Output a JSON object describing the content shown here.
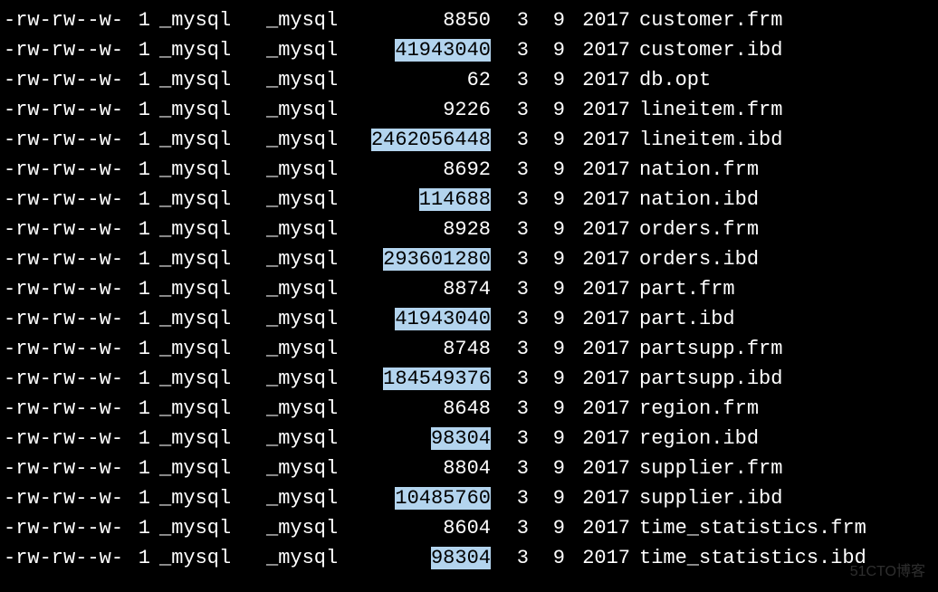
{
  "watermark": "51CTO博客",
  "listing": [
    {
      "perms": "-rw-rw--w-",
      "links": "1",
      "owner": "_mysql",
      "group": "_mysql",
      "size": "8850",
      "hl": false,
      "month": "3",
      "day": "9",
      "year": "2017",
      "name": "customer.frm"
    },
    {
      "perms": "-rw-rw--w-",
      "links": "1",
      "owner": "_mysql",
      "group": "_mysql",
      "size": "41943040",
      "hl": true,
      "month": "3",
      "day": "9",
      "year": "2017",
      "name": "customer.ibd"
    },
    {
      "perms": "-rw-rw--w-",
      "links": "1",
      "owner": "_mysql",
      "group": "_mysql",
      "size": "62",
      "hl": false,
      "month": "3",
      "day": "9",
      "year": "2017",
      "name": "db.opt"
    },
    {
      "perms": "-rw-rw--w-",
      "links": "1",
      "owner": "_mysql",
      "group": "_mysql",
      "size": "9226",
      "hl": false,
      "month": "3",
      "day": "9",
      "year": "2017",
      "name": "lineitem.frm"
    },
    {
      "perms": "-rw-rw--w-",
      "links": "1",
      "owner": "_mysql",
      "group": "_mysql",
      "size": "2462056448",
      "hl": true,
      "month": "3",
      "day": "9",
      "year": "2017",
      "name": "lineitem.ibd"
    },
    {
      "perms": "-rw-rw--w-",
      "links": "1",
      "owner": "_mysql",
      "group": "_mysql",
      "size": "8692",
      "hl": false,
      "month": "3",
      "day": "9",
      "year": "2017",
      "name": "nation.frm"
    },
    {
      "perms": "-rw-rw--w-",
      "links": "1",
      "owner": "_mysql",
      "group": "_mysql",
      "size": "114688",
      "hl": true,
      "month": "3",
      "day": "9",
      "year": "2017",
      "name": "nation.ibd"
    },
    {
      "perms": "-rw-rw--w-",
      "links": "1",
      "owner": "_mysql",
      "group": "_mysql",
      "size": "8928",
      "hl": false,
      "month": "3",
      "day": "9",
      "year": "2017",
      "name": "orders.frm"
    },
    {
      "perms": "-rw-rw--w-",
      "links": "1",
      "owner": "_mysql",
      "group": "_mysql",
      "size": "293601280",
      "hl": true,
      "month": "3",
      "day": "9",
      "year": "2017",
      "name": "orders.ibd"
    },
    {
      "perms": "-rw-rw--w-",
      "links": "1",
      "owner": "_mysql",
      "group": "_mysql",
      "size": "8874",
      "hl": false,
      "month": "3",
      "day": "9",
      "year": "2017",
      "name": "part.frm"
    },
    {
      "perms": "-rw-rw--w-",
      "links": "1",
      "owner": "_mysql",
      "group": "_mysql",
      "size": "41943040",
      "hl": true,
      "month": "3",
      "day": "9",
      "year": "2017",
      "name": "part.ibd"
    },
    {
      "perms": "-rw-rw--w-",
      "links": "1",
      "owner": "_mysql",
      "group": "_mysql",
      "size": "8748",
      "hl": false,
      "month": "3",
      "day": "9",
      "year": "2017",
      "name": "partsupp.frm"
    },
    {
      "perms": "-rw-rw--w-",
      "links": "1",
      "owner": "_mysql",
      "group": "_mysql",
      "size": "184549376",
      "hl": true,
      "month": "3",
      "day": "9",
      "year": "2017",
      "name": "partsupp.ibd"
    },
    {
      "perms": "-rw-rw--w-",
      "links": "1",
      "owner": "_mysql",
      "group": "_mysql",
      "size": "8648",
      "hl": false,
      "month": "3",
      "day": "9",
      "year": "2017",
      "name": "region.frm"
    },
    {
      "perms": "-rw-rw--w-",
      "links": "1",
      "owner": "_mysql",
      "group": "_mysql",
      "size": "98304",
      "hl": true,
      "month": "3",
      "day": "9",
      "year": "2017",
      "name": "region.ibd"
    },
    {
      "perms": "-rw-rw--w-",
      "links": "1",
      "owner": "_mysql",
      "group": "_mysql",
      "size": "8804",
      "hl": false,
      "month": "3",
      "day": "9",
      "year": "2017",
      "name": "supplier.frm"
    },
    {
      "perms": "-rw-rw--w-",
      "links": "1",
      "owner": "_mysql",
      "group": "_mysql",
      "size": "10485760",
      "hl": true,
      "month": "3",
      "day": "9",
      "year": "2017",
      "name": "supplier.ibd"
    },
    {
      "perms": "-rw-rw--w-",
      "links": "1",
      "owner": "_mysql",
      "group": "_mysql",
      "size": "8604",
      "hl": false,
      "month": "3",
      "day": "9",
      "year": "2017",
      "name": "time_statistics.frm"
    },
    {
      "perms": "-rw-rw--w-",
      "links": "1",
      "owner": "_mysql",
      "group": "_mysql",
      "size": "98304",
      "hl": true,
      "month": "3",
      "day": "9",
      "year": "2017",
      "name": "time_statistics.ibd"
    }
  ]
}
